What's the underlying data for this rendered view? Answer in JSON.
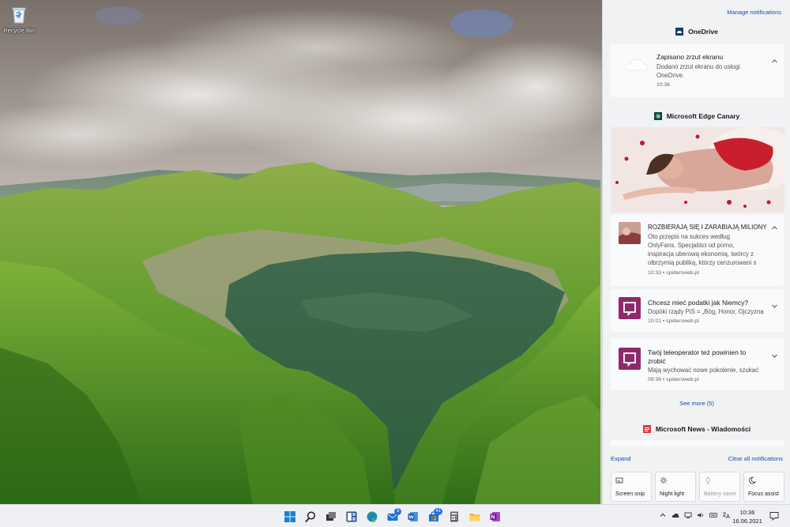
{
  "desktop": {
    "icons": [
      {
        "label": "Recycle Bin",
        "icon": "recycle-bin-icon"
      }
    ]
  },
  "notification_center": {
    "manage_label": "Manage notifications",
    "groups": {
      "onedrive": {
        "app_name": "OneDrive",
        "icon": "onedrive-icon",
        "notification": {
          "title": "Zapisano zrzut ekranu",
          "body_line1": "Dodano zrzut ekranu do usługi",
          "body_line2": "OneDrive.",
          "time": "10:36"
        }
      },
      "edge": {
        "app_name": "Microsoft Edge Canary",
        "icon": "edge-canary-icon",
        "items": [
          {
            "title": "ROZBIERAJĄ SIĘ I ZARABIAJĄ MILIONY",
            "body_line1": "Oto przepis na sukces według",
            "body_line2": "OnlyFans. Specjaliści od porno,",
            "body_line3": "inspiracja uberową ekonomią, twórcy z",
            "body_line4": "olbrzymią publiką, którzy cenzurowani s",
            "meta": "10:33 • spidersweb.pl"
          },
          {
            "title": "Chcesz mieć podatki jak Niemcy?",
            "body_line1": "Dopóki rządy PiS = „Bóg, Honor, Ojczyzna",
            "meta": "10:01 • spidersweb.pl"
          },
          {
            "title_line1": "Twój teleoperator też powinien to",
            "title_line2": "zrobić",
            "body_line1": "Mają wychować nowe pokolenie, szukać",
            "meta": "09:38 • spidersweb.pl"
          }
        ],
        "see_more": "See more (5)"
      },
      "news": {
        "app_name": "Microsoft News - Wiadomości",
        "icon": "microsoft-news-icon"
      }
    },
    "expand_label": "Expand",
    "clear_label": "Clear all notifications",
    "quick_actions": [
      {
        "label": "Screen snip",
        "icon": "screen-snip-icon",
        "state": "on"
      },
      {
        "label": "Night light",
        "icon": "night-light-icon",
        "state": "on"
      },
      {
        "label": "Battery saver",
        "icon": "battery-saver-icon",
        "state": "disabled"
      },
      {
        "label": "Focus assist",
        "icon": "focus-assist-icon",
        "state": "on"
      }
    ]
  },
  "taskbar": {
    "apps": [
      {
        "name": "Start",
        "icon": "windows-start-icon"
      },
      {
        "name": "Search",
        "icon": "search-icon"
      },
      {
        "name": "Task View",
        "icon": "task-view-icon"
      },
      {
        "name": "Widgets",
        "icon": "widgets-icon"
      },
      {
        "name": "Edge",
        "icon": "edge-icon"
      },
      {
        "name": "Mail",
        "icon": "mail-icon",
        "badge": "3"
      },
      {
        "name": "Word",
        "icon": "word-icon"
      },
      {
        "name": "Store",
        "icon": "store-icon",
        "badge": "41"
      },
      {
        "name": "Calculator",
        "icon": "calculator-icon"
      },
      {
        "name": "File Explorer",
        "icon": "file-explorer-icon"
      },
      {
        "name": "OneNote",
        "icon": "onenote-icon"
      }
    ],
    "clock": {
      "time": "10:36",
      "date": "16.06.2021"
    }
  }
}
